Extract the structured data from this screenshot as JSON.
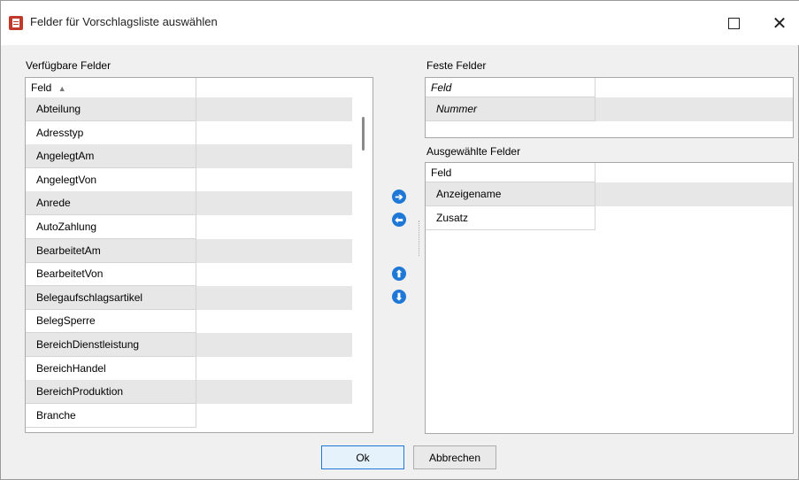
{
  "window": {
    "title": "Felder für Vorschlagsliste auswählen",
    "maximize_glyph": "□",
    "close_glyph": "✕"
  },
  "available": {
    "label": "Verfügbare Felder",
    "column_header": "Feld",
    "sort_glyph": "▲",
    "rows": [
      "Abteilung",
      "Adresstyp",
      "AngelegtAm",
      "AngelegtVon",
      "Anrede",
      "AutoZahlung",
      "BearbeitetAm",
      "BearbeitetVon",
      "Belegaufschlagsartikel",
      "BelegSperre",
      "BereichDienstleistung",
      "BereichHandel",
      "BereichProduktion",
      "Branche"
    ]
  },
  "fixed": {
    "label": "Feste Felder",
    "column_header": "Feld",
    "rows": [
      "Nummer"
    ]
  },
  "selected": {
    "label": "Ausgewählte Felder",
    "column_header": "Feld",
    "rows": [
      "Anzeigename",
      "Zusatz"
    ]
  },
  "actions": {
    "add_glyph": "➔",
    "remove_glyph": "⬅",
    "up_glyph": "⬆",
    "down_glyph": "⬇",
    "ok_label": "Ok",
    "cancel_label": "Abbrechen"
  },
  "icons": {
    "title_icon": "form-list-icon",
    "add": "arrow-right-circle-icon",
    "remove": "arrow-left-circle-icon",
    "up": "arrow-up-circle-icon",
    "down": "arrow-down-circle-icon"
  },
  "colors": {
    "accent": "#1f78d6",
    "row_alt": "#e7e7e7"
  }
}
